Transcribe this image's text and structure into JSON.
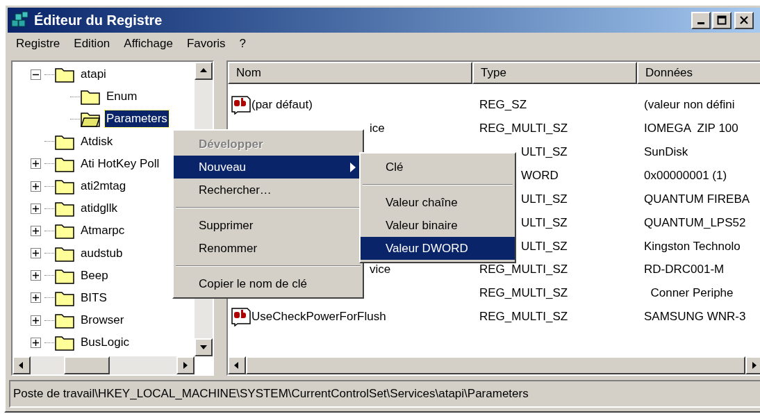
{
  "window": {
    "title": "Éditeur du Registre"
  },
  "menu_bar": [
    "Registre",
    "Edition",
    "Affichage",
    "Favoris",
    "?"
  ],
  "tree": [
    {
      "label": "atapi",
      "expanded": true,
      "selected": false,
      "children": [
        {
          "label": "Enum",
          "selected": false
        },
        {
          "label": "Parameters",
          "selected": true
        }
      ]
    },
    {
      "label": "Atdisk",
      "selected": false
    },
    {
      "label": "Ati HotKey Poll",
      "expanded": false,
      "selected": false
    },
    {
      "label": "ati2mtag",
      "expanded": false,
      "selected": false
    },
    {
      "label": "atidgllk",
      "expanded": false,
      "selected": false
    },
    {
      "label": "Atmarpc",
      "expanded": false,
      "selected": false
    },
    {
      "label": "audstub",
      "expanded": false,
      "selected": false
    },
    {
      "label": "Beep",
      "expanded": false,
      "selected": false
    },
    {
      "label": "BITS",
      "expanded": false,
      "selected": false
    },
    {
      "label": "Browser",
      "expanded": false,
      "selected": false
    },
    {
      "label": "BusLogic",
      "expanded": false,
      "selected": false
    }
  ],
  "table": {
    "columns": [
      "Nom",
      "Type",
      "Données"
    ],
    "rows": [
      {
        "name": "(par défaut)",
        "type": "REG_SZ",
        "data": "(valeur non défini"
      },
      {
        "name": "ice",
        "name_tail": true,
        "type": "REG_MULTI_SZ",
        "data": "IOMEGA  ZIP 100"
      },
      {
        "type": "ULTI_SZ",
        "type_tail": true,
        "data": "SunDisk"
      },
      {
        "type": "WORD",
        "type_tail": true,
        "data": "0x00000001 (1)"
      },
      {
        "type": "ULTI_SZ",
        "type_tail": true,
        "data": "QUANTUM FIREBA"
      },
      {
        "type": "ULTI_SZ",
        "type_tail": true,
        "data": "QUANTUM_LPS52"
      },
      {
        "type": "ULTI_SZ",
        "type_tail": true,
        "data": "Kingston Technolo"
      },
      {
        "name": "vice",
        "name_tail": true,
        "type": "REG_MULTI_SZ",
        "data": "RD-DRC001-M"
      },
      {
        "type": "REG_MULTI_SZ",
        "data": "  Conner Periphe"
      },
      {
        "name": "UseCheckPowerForFlush",
        "type": "REG_MULTI_SZ",
        "data": "SAMSUNG WNR-3"
      }
    ]
  },
  "context_menu": [
    {
      "kind": "item",
      "label": "Développer",
      "disabled": true,
      "selected": false
    },
    {
      "kind": "item",
      "label": "Nouveau",
      "disabled": false,
      "selected": true,
      "submenu": true
    },
    {
      "kind": "item",
      "label": "Rechercher…",
      "disabled": false,
      "selected": false
    },
    {
      "kind": "separator"
    },
    {
      "kind": "item",
      "label": "Supprimer",
      "disabled": false,
      "selected": false
    },
    {
      "kind": "item",
      "label": "Renommer",
      "disabled": false,
      "selected": false
    },
    {
      "kind": "separator"
    },
    {
      "kind": "item",
      "label": "Copier le nom de clé",
      "disabled": false,
      "selected": false
    }
  ],
  "submenu": [
    {
      "kind": "item",
      "label": "Clé",
      "selected": false
    },
    {
      "kind": "separator"
    },
    {
      "kind": "item",
      "label": "Valeur chaîne",
      "selected": false
    },
    {
      "kind": "item",
      "label": "Valeur binaire",
      "selected": false
    },
    {
      "kind": "item",
      "label": "Valeur DWORD",
      "selected": true
    }
  ],
  "status_bar": "Poste de travail\\HKEY_LOCAL_MACHINE\\SYSTEM\\CurrentControlSet\\Services\\atapi\\Parameters"
}
